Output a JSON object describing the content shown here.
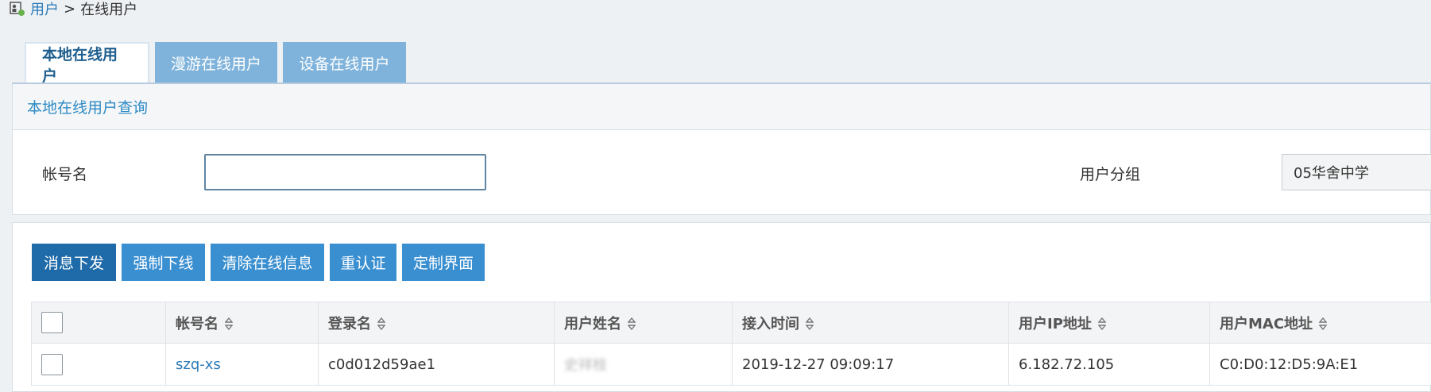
{
  "breadcrumb": {
    "icon": "user-group-icon",
    "parent": "用户",
    "separator": ">",
    "current": "在线用户"
  },
  "tabs": [
    {
      "label": "本地在线用户",
      "active": true
    },
    {
      "label": "漫游在线用户",
      "active": false
    },
    {
      "label": "设备在线用户",
      "active": false
    }
  ],
  "query": {
    "title": "本地在线用户查询",
    "account_label": "帐号名",
    "account_value": "",
    "group_label": "用户分组",
    "group_value": "05华舍中学"
  },
  "actions": [
    "消息下发",
    "强制下线",
    "清除在线信息",
    "重认证",
    "定制界面"
  ],
  "table": {
    "columns": [
      "帐号名",
      "登录名",
      "用户姓名",
      "接入时间",
      "用户IP地址",
      "用户MAC地址"
    ],
    "rows": [
      {
        "account": "szq-xs",
        "login": "c0d012d59ae1",
        "name": "史祥枝",
        "access_time": "2019-12-27 09:09:17",
        "ip": "6.182.72.105",
        "mac": "C0:D0:12:D5:9A:E1"
      }
    ]
  },
  "colors": {
    "tab_inactive": "#7fb3db",
    "button": "#3a8fd0",
    "button_primary": "#1f6aa8",
    "link": "#2a7ab8"
  }
}
